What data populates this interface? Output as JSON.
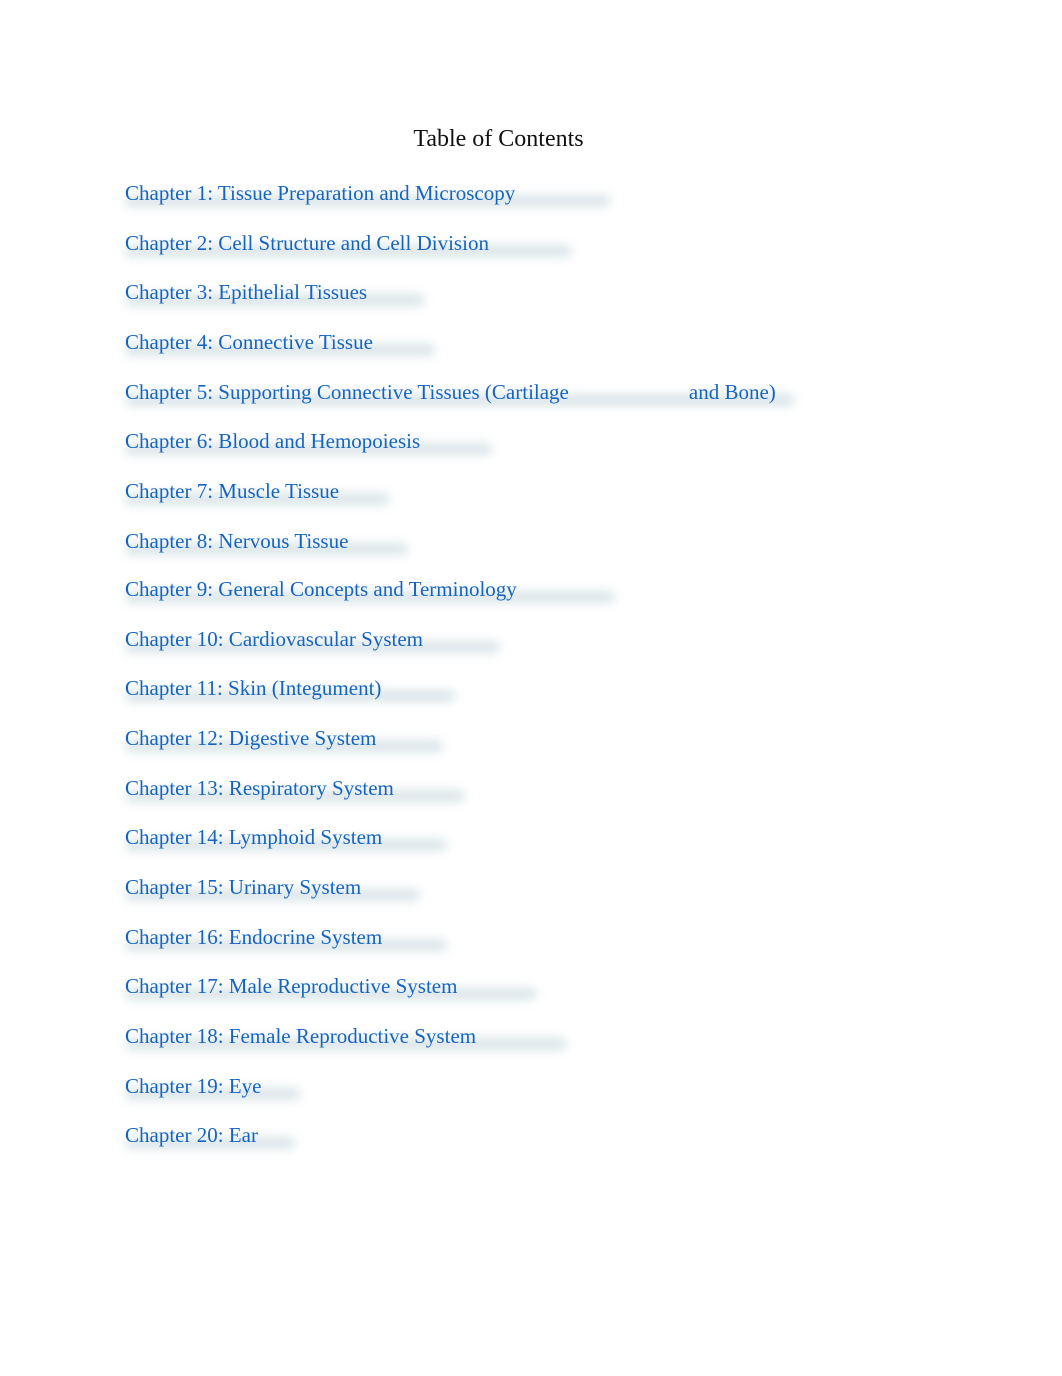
{
  "document": {
    "title": "Table of Contents",
    "link_color": "#1565c0",
    "entries": [
      {
        "label": "Chapter 1: Tissue Preparation and Microscopy"
      },
      {
        "label": "Chapter 2: Cell Structure and Cell Division"
      },
      {
        "label": "Chapter 3: Epithelial Tissues"
      },
      {
        "label": "Chapter 4: Connective Tissue"
      },
      {
        "label_part1": "Chapter 5: Supporting Connective Tissues (Cartilage",
        "label_part2": "and Bone)"
      },
      {
        "label": "Chapter 6: Blood and Hemopoiesis"
      },
      {
        "label": "Chapter 7: Muscle Tissue"
      },
      {
        "label": "Chapter 8: Nervous Tissue"
      },
      {
        "label": "Chapter 9: General Concepts and Terminology"
      },
      {
        "label": "Chapter 10: Cardiovascular System"
      },
      {
        "label": "Chapter 11: Skin (Integument)"
      },
      {
        "label": "Chapter 12: Digestive System"
      },
      {
        "label": "Chapter 13: Respiratory System"
      },
      {
        "label": "Chapter 14: Lymphoid System"
      },
      {
        "label": "Chapter 15: Urinary System"
      },
      {
        "label": "Chapter 16: Endocrine System"
      },
      {
        "label": "Chapter 17: Male Reproductive System"
      },
      {
        "label": "Chapter 18: Female Reproductive System"
      },
      {
        "label": "Chapter 19: Eye"
      },
      {
        "label": "Chapter 20: Ear"
      }
    ]
  }
}
